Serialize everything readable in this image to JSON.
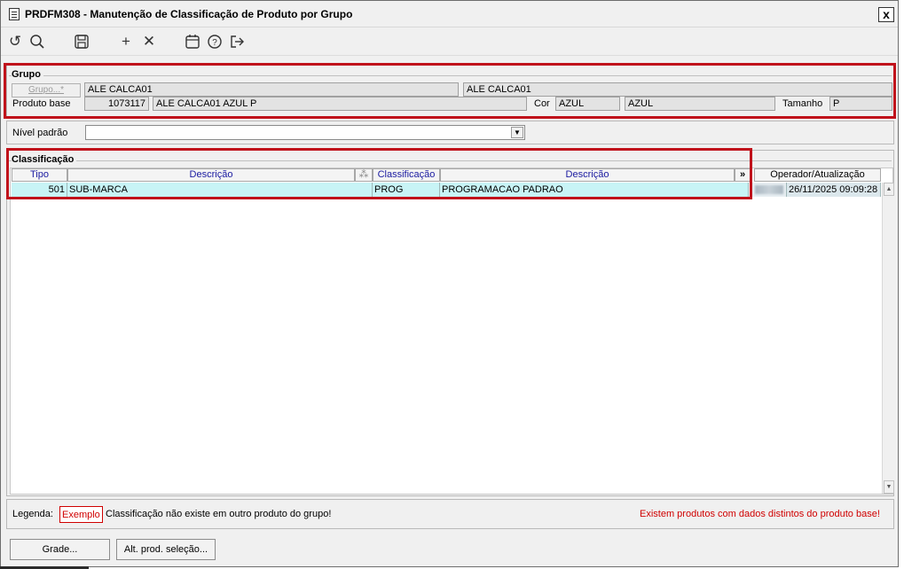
{
  "window": {
    "title": "PRDFM308 - Manutenção de Classificação de Produto por Grupo",
    "close": "x"
  },
  "toolbar": {
    "icons": [
      "undo-icon",
      "search-icon",
      "save-icon",
      "add-icon",
      "delete-icon",
      "calendar-icon",
      "help-icon",
      "exit-icon"
    ],
    "glyphs": {
      "undo": "↺",
      "search": "⌕",
      "save": "🖫",
      "add": "+",
      "delete": "✕",
      "calendar": "▦",
      "help": "?",
      "exit": "⇥"
    }
  },
  "grupo": {
    "legend": "Grupo",
    "grupo_button": "Grupo...*",
    "grupo_code": "ALE CALCA01",
    "grupo_desc": "ALE CALCA01",
    "produto_base_label": "Produto base",
    "produto_base_code": "1073117",
    "produto_base_desc": "ALE CALCA01 AZUL P",
    "cor_label": "Cor",
    "cor_code": "AZUL",
    "cor_desc": "AZUL",
    "tamanho_label": "Tamanho",
    "tamanho_value": "P"
  },
  "nivel": {
    "label": "Nível padrão",
    "value": ""
  },
  "classificacao": {
    "legend": "Classificação",
    "columns": {
      "tipo": "Tipo",
      "descricao1": "Descrição",
      "sort_marker": "⁂",
      "classificacao": "Classificação",
      "descricao2": "Descrição",
      "more": "»",
      "operador": "Operador/Atualização"
    },
    "rows": [
      {
        "tipo": "501",
        "descricao": "SUB-MARCA",
        "classificacao": "PROG",
        "descricao2": "PROGRAMACAO PADRAO",
        "atualizacao": "26/11/2025 09:09:28"
      }
    ]
  },
  "legenda": {
    "label": "Legenda:",
    "exemplo": "Exemplo",
    "text": "Classificação não existe em outro produto do grupo!",
    "warning": "Existem produtos com dados distintos do produto base!",
    "colors": {
      "exemplo": "#d00000",
      "warning": "#d00000"
    }
  },
  "footer": {
    "grade_button": "Grade...",
    "alt_button": "Alt. prod. seleção..."
  }
}
